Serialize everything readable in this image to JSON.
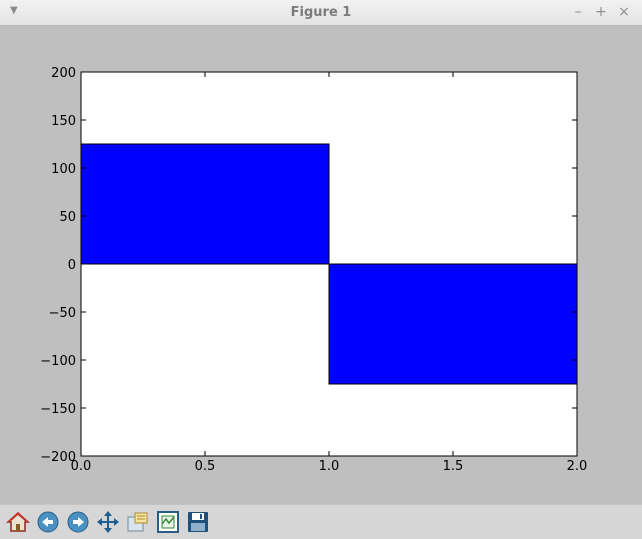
{
  "window": {
    "title": "Figure 1",
    "menu_icon": "dropdown-arrow-icon",
    "controls": [
      "minimize-icon",
      "maximize-icon",
      "close-icon"
    ],
    "control_glyphs": {
      "minimize": "–",
      "maximize": "+",
      "close": "×"
    },
    "menu_glyph": "▼"
  },
  "toolbar": {
    "tools": [
      {
        "name": "home-icon"
      },
      {
        "name": "back-icon"
      },
      {
        "name": "forward-icon"
      },
      {
        "name": "pan-icon"
      },
      {
        "name": "zoom-icon"
      },
      {
        "name": "configure-subplots-icon"
      },
      {
        "name": "save-icon"
      }
    ]
  },
  "colors": {
    "bar_fill": "#0000ff",
    "figure_bg": "#bfbfbf",
    "axes_bg": "#ffffff"
  },
  "chart_data": {
    "type": "bar",
    "bars": [
      {
        "x0": 0.0,
        "x1": 1.0,
        "value": 125
      },
      {
        "x0": 1.0,
        "x1": 2.0,
        "value": -125
      }
    ],
    "xlim": [
      0.0,
      2.0
    ],
    "ylim": [
      -200,
      200
    ],
    "xticks": [
      0.0,
      0.5,
      1.0,
      1.5,
      2.0
    ],
    "xtick_labels": [
      "0.0",
      "0.5",
      "1.0",
      "1.5",
      "2.0"
    ],
    "yticks": [
      200,
      150,
      100,
      50,
      0,
      -50,
      -100,
      -150,
      -200
    ],
    "ytick_labels": [
      "200",
      "150",
      "100",
      "50",
      "0",
      "−50",
      "−100",
      "−150",
      "−200"
    ],
    "grid": false
  }
}
